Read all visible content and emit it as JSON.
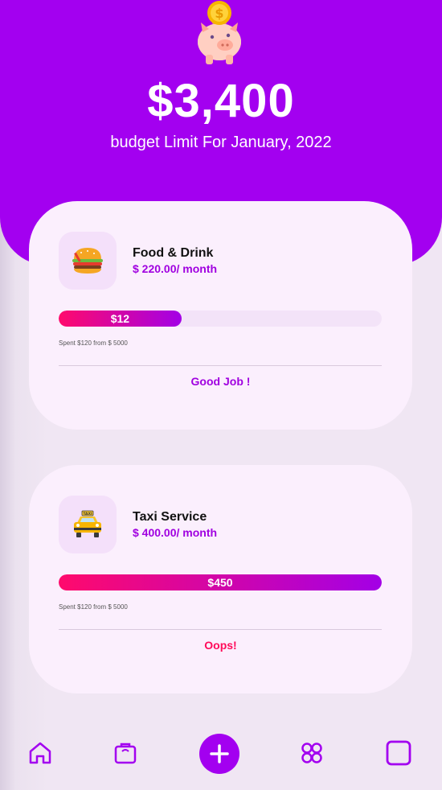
{
  "header": {
    "amount": "$3,400",
    "subtitle": "budget Limit For January, 2022"
  },
  "budgets": [
    {
      "icon": "burger-icon",
      "title": "Food & Drink",
      "rate": "$ 220.00/ month",
      "progress_label": "$12",
      "progress_fraction": 0.38,
      "spent_text": "Spent $120 from $ 5000",
      "status": "Good Job !"
    },
    {
      "icon": "taxi-icon",
      "title": "Taxi Service",
      "rate": "$ 400.00/ month",
      "progress_label": "$450",
      "progress_fraction": 1.0,
      "spent_text": "Spent $120 from $ 5000",
      "status": "Oops!"
    }
  ],
  "nav": {
    "items": [
      "home-icon",
      "wallet-icon",
      "add-icon",
      "grid-icon",
      "square-icon"
    ]
  },
  "colors": {
    "accent": "#a300f0",
    "danger": "#ff0a5a",
    "card": "#fbeffd"
  }
}
